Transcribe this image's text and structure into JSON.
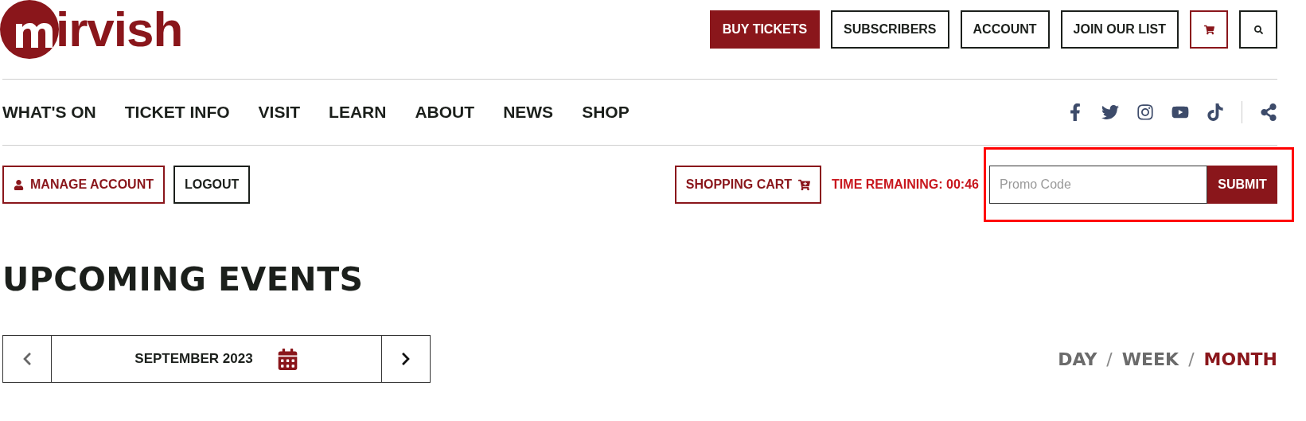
{
  "logo": {
    "letters": "irvish"
  },
  "top_buttons": [
    {
      "label": "BUY TICKETS",
      "kind": "primary"
    },
    {
      "label": "SUBSCRIBERS",
      "kind": "outline"
    },
    {
      "label": "ACCOUNT",
      "kind": "outline"
    },
    {
      "label": "JOIN OUR LIST",
      "kind": "outline"
    },
    {
      "kind": "cart"
    },
    {
      "kind": "search"
    }
  ],
  "nav": [
    "WHAT'S ON",
    "TICKET INFO",
    "VISIT",
    "LEARN",
    "ABOUT",
    "NEWS",
    "SHOP"
  ],
  "social": [
    {
      "kind": "facebook"
    },
    {
      "kind": "twitter"
    },
    {
      "kind": "instagram"
    },
    {
      "kind": "youtube"
    },
    {
      "kind": "tiktok"
    },
    {
      "kind": "share"
    }
  ],
  "account_bar": {
    "manage": "MANAGE ACCOUNT",
    "logout": "LOGOUT",
    "cart": "SHOPPING CART",
    "timer": "TIME REMAINING: 00:46"
  },
  "promo": {
    "placeholder": "Promo Code",
    "submit": "SUBMIT",
    "highlighted": true
  },
  "heading": "UPCOMING EVENTS",
  "calendar": {
    "month": "SEPTEMBER 2023"
  },
  "views": [
    {
      "label": "DAY",
      "selected": false
    },
    {
      "label": "WEEK",
      "selected": false
    },
    {
      "label": "MONTH",
      "selected": true
    }
  ],
  "view_separator": "/"
}
